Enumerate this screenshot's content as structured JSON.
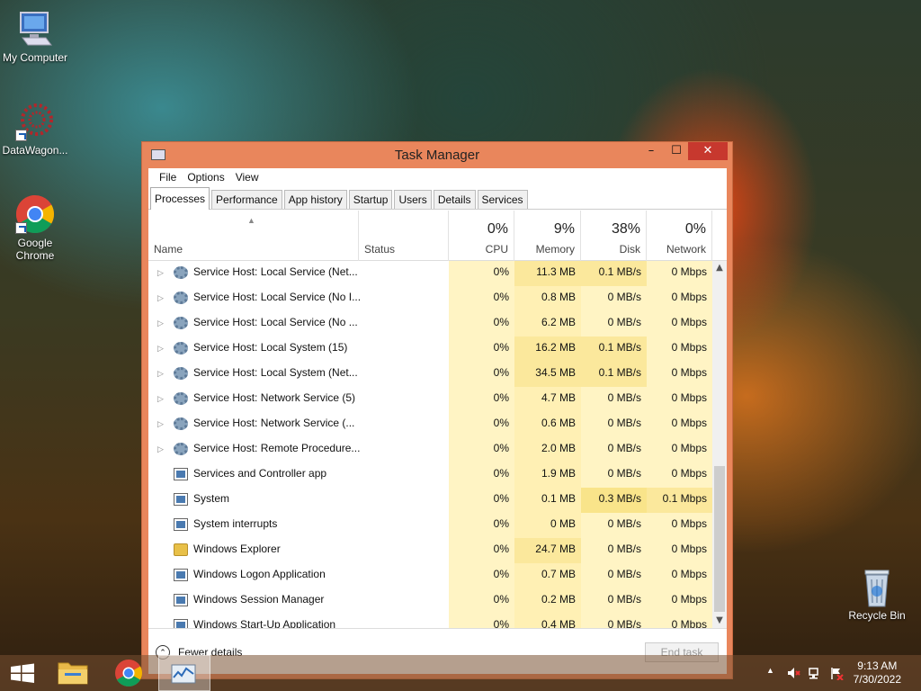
{
  "desktop": {
    "icons": [
      {
        "label": "My Computer",
        "icon": "computer-icon"
      },
      {
        "label": "DataWagon...",
        "icon": "datawagon-icon"
      },
      {
        "label": "Google Chrome",
        "icon": "chrome-icon"
      },
      {
        "label": "Recycle Bin",
        "icon": "recycle-bin-icon"
      }
    ]
  },
  "window": {
    "title": "Task Manager",
    "controls": {
      "minimize": "–",
      "maximize": "☐",
      "close": "✕"
    },
    "menu": [
      "File",
      "Options",
      "View"
    ],
    "tabs": [
      "Processes",
      "Performance",
      "App history",
      "Startup",
      "Users",
      "Details",
      "Services"
    ],
    "active_tab": "Processes",
    "columns": {
      "name": "Name",
      "status": "Status",
      "cpu": {
        "pct": "0%",
        "label": "CPU"
      },
      "memory": {
        "pct": "9%",
        "label": "Memory"
      },
      "disk": {
        "pct": "38%",
        "label": "Disk"
      },
      "network": {
        "pct": "0%",
        "label": "Network"
      }
    },
    "processes": [
      {
        "name": "Service Host: Local Service (Net...",
        "icon": "gear",
        "expandable": true,
        "cpu": "0%",
        "memory": "11.3 MB",
        "disk": "0.1 MB/s",
        "network": "0 Mbps"
      },
      {
        "name": "Service Host: Local Service (No I...",
        "icon": "gear",
        "expandable": true,
        "cpu": "0%",
        "memory": "0.8 MB",
        "disk": "0 MB/s",
        "network": "0 Mbps"
      },
      {
        "name": "Service Host: Local Service (No ...",
        "icon": "gear",
        "expandable": true,
        "cpu": "0%",
        "memory": "6.2 MB",
        "disk": "0 MB/s",
        "network": "0 Mbps"
      },
      {
        "name": "Service Host: Local System (15)",
        "icon": "gear",
        "expandable": true,
        "cpu": "0%",
        "memory": "16.2 MB",
        "disk": "0.1 MB/s",
        "network": "0 Mbps"
      },
      {
        "name": "Service Host: Local System (Net...",
        "icon": "gear",
        "expandable": true,
        "cpu": "0%",
        "memory": "34.5 MB",
        "disk": "0.1 MB/s",
        "network": "0 Mbps"
      },
      {
        "name": "Service Host: Network Service (5)",
        "icon": "gear",
        "expandable": true,
        "cpu": "0%",
        "memory": "4.7 MB",
        "disk": "0 MB/s",
        "network": "0 Mbps"
      },
      {
        "name": "Service Host: Network Service (...",
        "icon": "gear",
        "expandable": true,
        "cpu": "0%",
        "memory": "0.6 MB",
        "disk": "0 MB/s",
        "network": "0 Mbps"
      },
      {
        "name": "Service Host: Remote Procedure...",
        "icon": "gear",
        "expandable": true,
        "cpu": "0%",
        "memory": "2.0 MB",
        "disk": "0 MB/s",
        "network": "0 Mbps"
      },
      {
        "name": "Services and Controller app",
        "icon": "win",
        "expandable": false,
        "cpu": "0%",
        "memory": "1.9 MB",
        "disk": "0 MB/s",
        "network": "0 Mbps"
      },
      {
        "name": "System",
        "icon": "win",
        "expandable": false,
        "cpu": "0%",
        "memory": "0.1 MB",
        "disk": "0.3 MB/s",
        "network": "0.1 Mbps"
      },
      {
        "name": "System interrupts",
        "icon": "win",
        "expandable": false,
        "cpu": "0%",
        "memory": "0 MB",
        "disk": "0 MB/s",
        "network": "0 Mbps"
      },
      {
        "name": "Windows Explorer",
        "icon": "folder",
        "expandable": false,
        "cpu": "0%",
        "memory": "24.7 MB",
        "disk": "0 MB/s",
        "network": "0 Mbps"
      },
      {
        "name": "Windows Logon Application",
        "icon": "win",
        "expandable": false,
        "cpu": "0%",
        "memory": "0.7 MB",
        "disk": "0 MB/s",
        "network": "0 Mbps"
      },
      {
        "name": "Windows Session Manager",
        "icon": "win",
        "expandable": false,
        "cpu": "0%",
        "memory": "0.2 MB",
        "disk": "0 MB/s",
        "network": "0 Mbps"
      },
      {
        "name": "Windows Start-Up Application",
        "icon": "win",
        "expandable": false,
        "cpu": "0%",
        "memory": "0.4 MB",
        "disk": "0 MB/s",
        "network": "0 Mbps"
      }
    ],
    "footer": {
      "fewer_details": "Fewer details",
      "end_task": "End task"
    }
  },
  "taskbar": {
    "time": "9:13 AM",
    "date": "7/30/2022",
    "tray_chevron": "▲"
  }
}
